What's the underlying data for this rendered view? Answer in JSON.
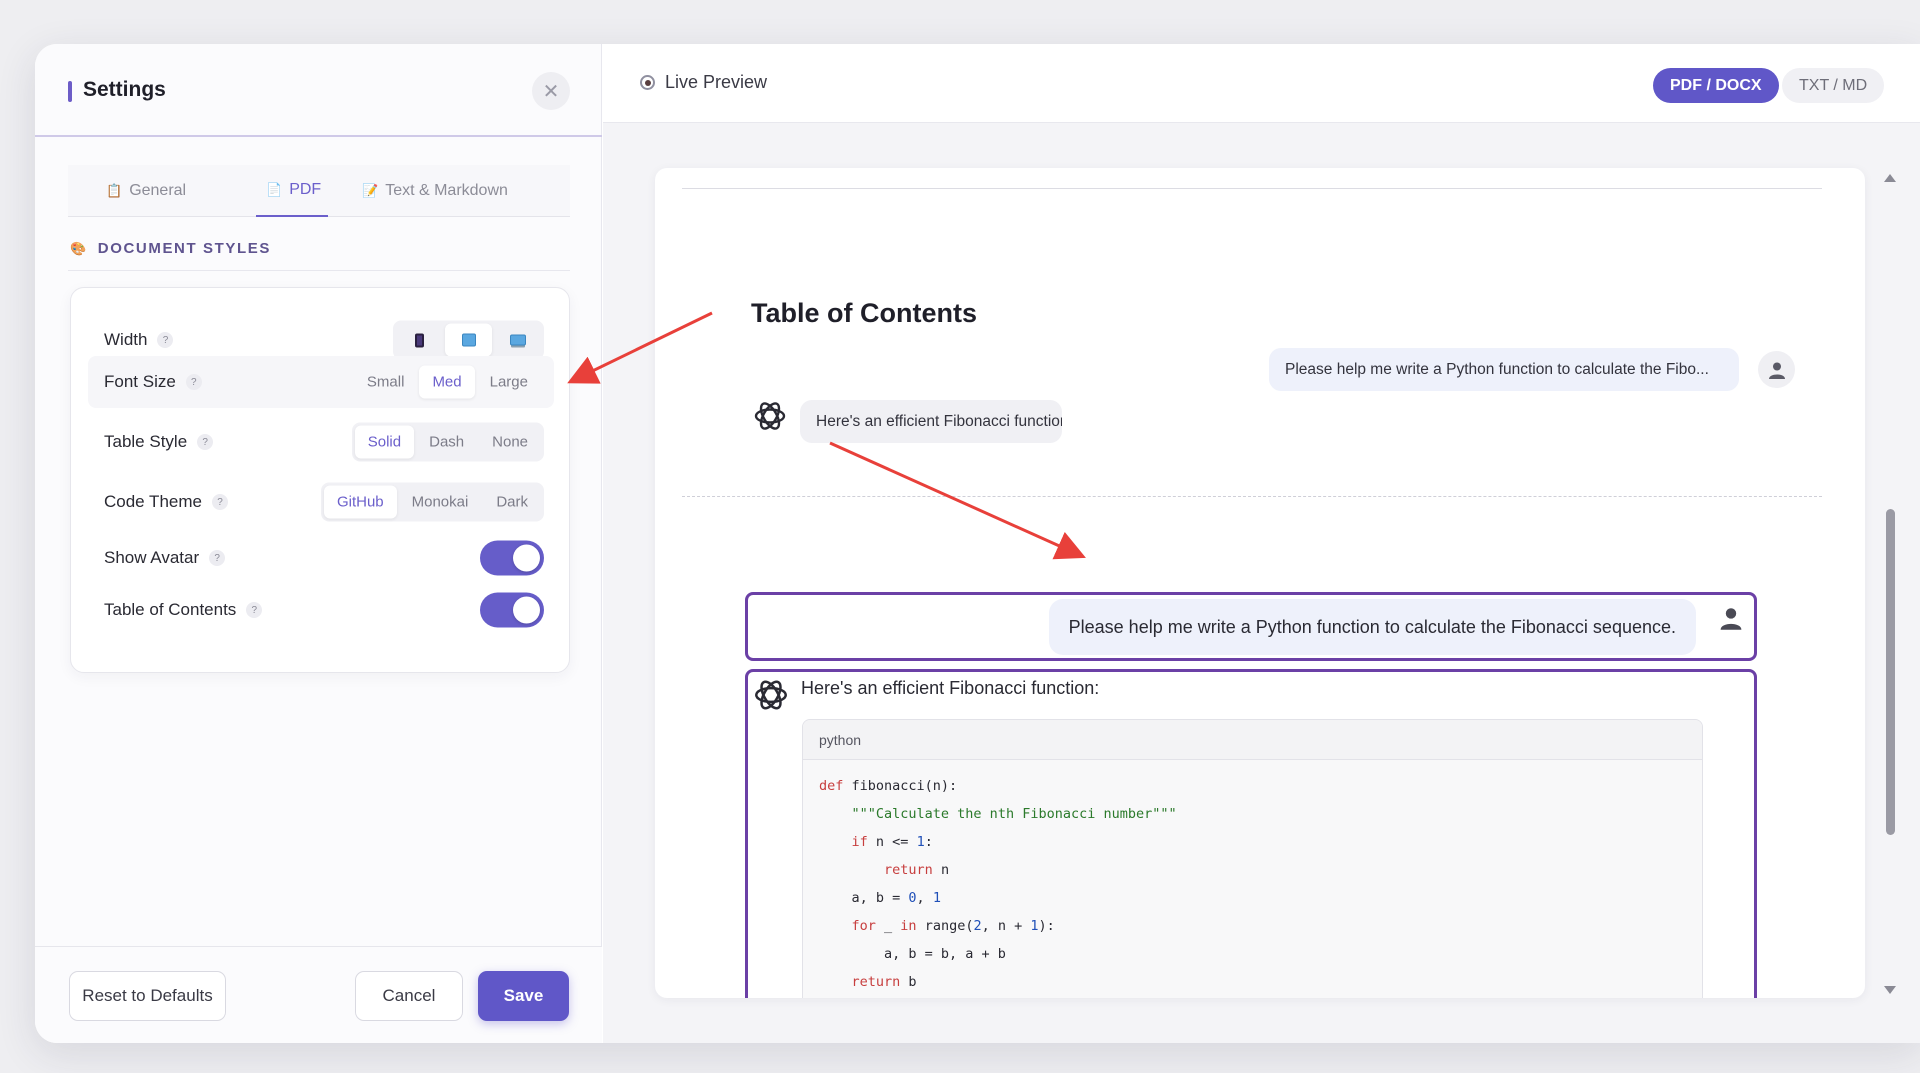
{
  "settings": {
    "title": "Settings",
    "tabs": [
      {
        "label": "General",
        "icon": "clipboard-icon"
      },
      {
        "label": "PDF",
        "icon": "pdf-page-icon"
      },
      {
        "label": "Text & Markdown",
        "icon": "pencil-memo-icon"
      }
    ],
    "active_tab": "PDF",
    "section_title": "DOCUMENT STYLES",
    "rows": {
      "width": {
        "label": "Width",
        "options": [
          "phone-icon",
          "tablet-icon",
          "desktop-icon"
        ],
        "selected": "tablet-icon"
      },
      "font_size": {
        "label": "Font Size",
        "options": [
          "Small",
          "Med",
          "Large"
        ],
        "selected": "Med"
      },
      "table_style": {
        "label": "Table Style",
        "options": [
          "Solid",
          "Dash",
          "None"
        ],
        "selected": "Solid"
      },
      "code_theme": {
        "label": "Code Theme",
        "options": [
          "GitHub",
          "Monokai",
          "Dark"
        ],
        "selected": "GitHub"
      },
      "show_avatar": {
        "label": "Show Avatar",
        "on": true
      },
      "toc": {
        "label": "Table of Contents",
        "on": true
      }
    },
    "help_mark": "?",
    "buttons": {
      "reset": "Reset to Defaults",
      "cancel": "Cancel",
      "save": "Save"
    }
  },
  "preview": {
    "title": "Live Preview",
    "formats": [
      "PDF / DOCX",
      "TXT / MD"
    ],
    "selected_format": "PDF / DOCX",
    "toc_title": "Table of Contents",
    "toc_user": "Please help me write a Python function to calculate the Fibo...",
    "toc_ai": "Here's an efficient Fibonacci function:...",
    "user_message": "Please help me write a Python function to calculate the Fibonacci sequence.",
    "ai_message": "Here's an efficient Fibonacci function:",
    "code_lang": "python",
    "code_lines": [
      "def fibonacci(n):",
      "    \"\"\"Calculate the nth Fibonacci number\"\"\"",
      "    if n <= 1:",
      "        return n",
      "    a, b = 0, 1",
      "    for _ in range(2, n + 1):",
      "        a, b = b, a + b",
      "    return b"
    ]
  },
  "colors": {
    "accent": "#6057c8",
    "message_border": "#6b40a6",
    "annotation_arrow": "#e8403a"
  }
}
